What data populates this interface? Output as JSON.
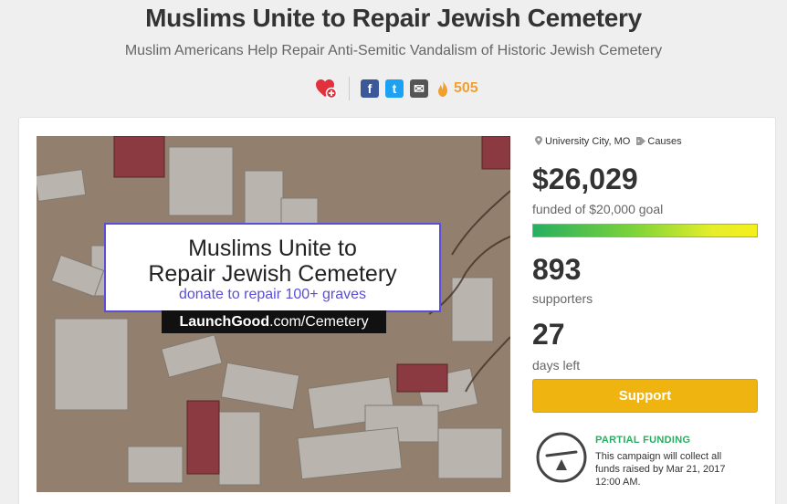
{
  "campaign": {
    "title": "Muslims Unite to Repair Jewish Cemetery",
    "subtitle": "Muslim Americans Help Repair Anti-Semitic Vandalism of Historic Jewish Cemetery"
  },
  "share": {
    "icons": [
      "heart-plus-icon",
      "facebook-icon",
      "twitter-icon",
      "email-icon",
      "flame-icon"
    ],
    "facebook_glyph": "f",
    "twitter_glyph": "t",
    "email_glyph": "✉",
    "count": "505"
  },
  "banner": {
    "line1": "Muslims Unite to",
    "line2": "Repair Jewish Cemetery",
    "line3": "donate to repair 100+ graves",
    "brand": "LaunchGood",
    "url": ".com/Cemetery"
  },
  "sidebar": {
    "location": "University City, MO",
    "category": "Causes",
    "amount": "$26,029",
    "funded_label": "funded of $20,000 goal",
    "progress_fraction": 1.0,
    "supporters": "893",
    "supporters_label": "supporters",
    "days": "27",
    "days_label": "days left",
    "support_button": "Support",
    "partial_title": "PARTIAL FUNDING",
    "partial_text": "This campaign will collect all funds raised by Mar 21, 2017 12:00 AM."
  },
  "colors": {
    "accent_yellow": "#f0b410",
    "partial_green": "#27ae60",
    "facebook": "#3b5998",
    "twitter": "#1da1f2",
    "count_orange": "#f0a030",
    "banner_purple": "#5a4ed6"
  }
}
